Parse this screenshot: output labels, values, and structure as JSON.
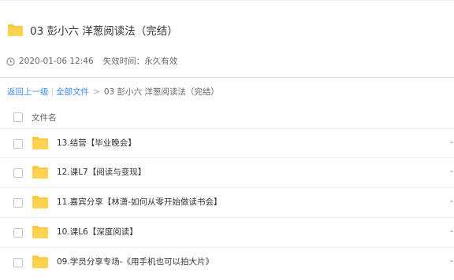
{
  "header": {
    "title": "03 彭小六 洋葱阅读法（完结）",
    "date": "2020-01-06 12:46",
    "expire_label": "失效时间：永久有效"
  },
  "breadcrumb": {
    "back": "返回上一级",
    "separator": "|",
    "all_files": "全部文件",
    "arrow": ">",
    "current": "03 彭小六 洋葱阅读法（完结）"
  },
  "list": {
    "column_name": "文件名",
    "rows": [
      {
        "name": "13.结营【毕业晚会】",
        "size": "-"
      },
      {
        "name": "12.课L7【阅读与变现】",
        "size": "-"
      },
      {
        "name": "11.嘉宾分享【林潇-如何从零开始做读书会】",
        "size": "-"
      },
      {
        "name": "10.课L6【深度阅读】",
        "size": "-"
      },
      {
        "name": "09.学员分享专场-《用手机也可以拍大片》",
        "size": "-"
      }
    ]
  },
  "colors": {
    "folder": "#ffc83d",
    "link": "#3b8cff",
    "text": "#333333",
    "muted": "#666666"
  }
}
